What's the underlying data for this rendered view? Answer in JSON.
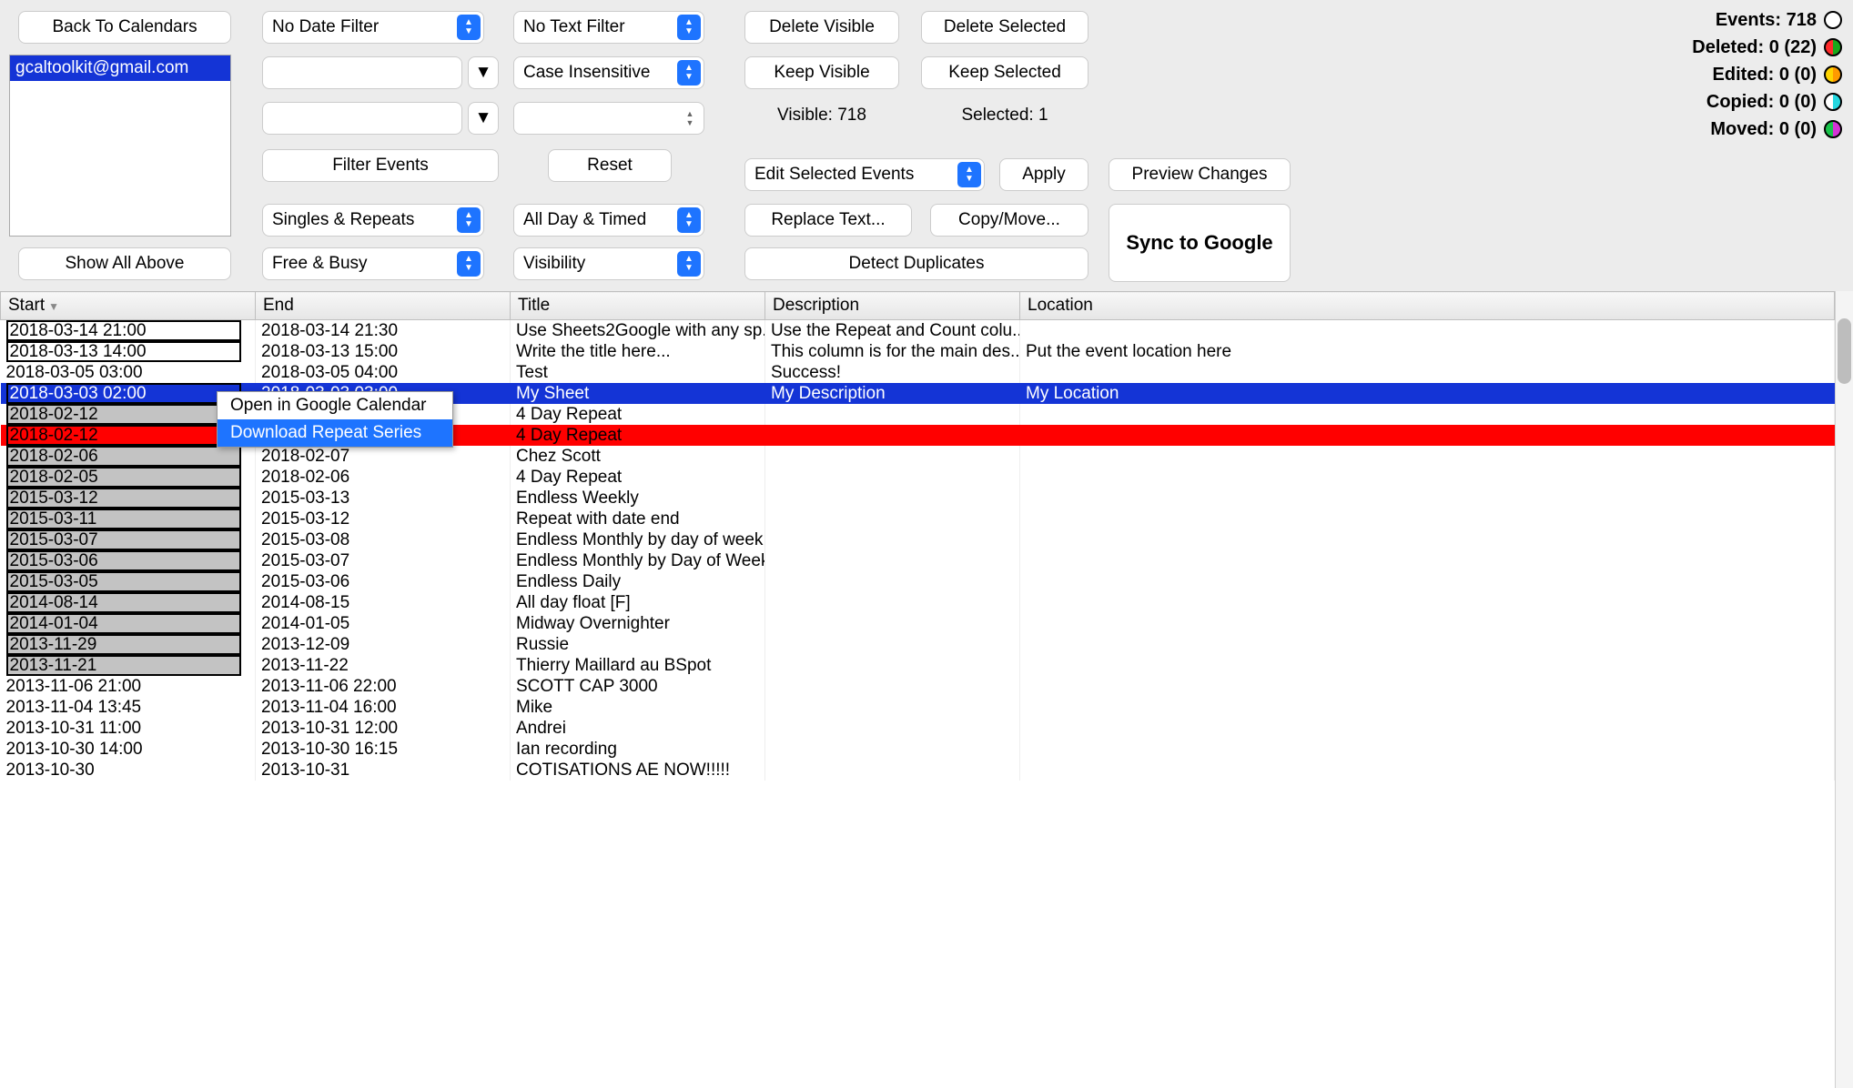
{
  "buttons": {
    "back": "Back To Calendars",
    "show_all": "Show All Above",
    "filter_events": "Filter Events",
    "reset": "Reset",
    "delete_visible": "Delete Visible",
    "delete_selected": "Delete Selected",
    "keep_visible": "Keep Visible",
    "keep_selected": "Keep Selected",
    "apply": "Apply",
    "replace_text": "Replace Text...",
    "copy_move": "Copy/Move...",
    "detect_dup": "Detect Duplicates",
    "preview": "Preview Changes",
    "sync": "Sync to Google"
  },
  "selects": {
    "date_filter": "No Date Filter",
    "text_filter": "No Text Filter",
    "case": "Case Insensitive",
    "singles": "Singles & Repeats",
    "allday": "All Day & Timed",
    "freebusy": "Free & Busy",
    "visibility": "Visibility",
    "edit_selected": "Edit Selected Events"
  },
  "calendars": [
    "gcaltoolkit@gmail.com"
  ],
  "status": {
    "visible": "Visible: 718",
    "selected": "Selected: 1"
  },
  "stats": {
    "events": "Events: 718",
    "deleted": "Deleted: 0 (22)",
    "edited": "Edited: 0 (0)",
    "copied": "Copied: 0 (0)",
    "moved": "Moved: 0 (0)"
  },
  "context_menu": {
    "open": "Open in Google Calendar",
    "download": "Download Repeat Series"
  },
  "columns": {
    "start": "Start",
    "end": "End",
    "title": "Title",
    "description": "Description",
    "location": "Location"
  },
  "rows": [
    {
      "start": "2018-03-14 21:00",
      "end": "2018-03-14 21:30",
      "title": "Use Sheets2Google with any sp...",
      "desc": "Use the Repeat and Count colu...",
      "loc": "",
      "box": true
    },
    {
      "start": "2018-03-13 14:00",
      "end": "2018-03-13 15:00",
      "title": "Write the title here...",
      "desc": "This column is for the main des...",
      "loc": "Put the event location here",
      "box": true
    },
    {
      "start": "2018-03-05 03:00",
      "end": "2018-03-05 04:00",
      "title": "Test",
      "desc": "Success!",
      "loc": ""
    },
    {
      "start": "2018-03-03 02:00",
      "end": "2018-03-03 03:00",
      "title": "My Sheet",
      "desc": "My Description",
      "loc": "My Location",
      "selected": true,
      "box": true
    },
    {
      "start": "2018-02-12",
      "end": "",
      "title": "4 Day Repeat",
      "desc": "",
      "loc": "",
      "gray": true,
      "box": true
    },
    {
      "start": "2018-02-12",
      "end": "",
      "title": "4 Day Repeat",
      "desc": "",
      "loc": "",
      "red": true,
      "box": true
    },
    {
      "start": "2018-02-06",
      "end": "2018-02-07",
      "title": "Chez Scott",
      "desc": "",
      "loc": "",
      "gray": true,
      "box": true
    },
    {
      "start": "2018-02-05",
      "end": "2018-02-06",
      "title": "4 Day Repeat",
      "desc": "",
      "loc": "",
      "gray": true,
      "box": true
    },
    {
      "start": "2015-03-12",
      "end": "2015-03-13",
      "title": "Endless Weekly",
      "desc": "",
      "loc": "",
      "gray": true,
      "box": true
    },
    {
      "start": "2015-03-11",
      "end": "2015-03-12",
      "title": "Repeat with date end",
      "desc": "",
      "loc": "",
      "gray": true,
      "box": true
    },
    {
      "start": "2015-03-07",
      "end": "2015-03-08",
      "title": "Endless Monthly by day of week",
      "desc": "",
      "loc": "",
      "gray": true,
      "box": true
    },
    {
      "start": "2015-03-06",
      "end": "2015-03-07",
      "title": "Endless Monthly by Day of Week",
      "desc": "",
      "loc": "",
      "gray": true,
      "box": true
    },
    {
      "start": "2015-03-05",
      "end": "2015-03-06",
      "title": "Endless Daily",
      "desc": "",
      "loc": "",
      "gray": true,
      "box": true
    },
    {
      "start": "2014-08-14",
      "end": "2014-08-15",
      "title": "All day float [F]",
      "desc": "",
      "loc": "",
      "gray": true,
      "box": true
    },
    {
      "start": "2014-01-04",
      "end": "2014-01-05",
      "title": "Midway Overnighter",
      "desc": "",
      "loc": "",
      "gray": true,
      "box": true
    },
    {
      "start": "2013-11-29",
      "end": "2013-12-09",
      "title": "Russie",
      "desc": "",
      "loc": "",
      "gray": true,
      "box": true
    },
    {
      "start": "2013-11-21",
      "end": "2013-11-22",
      "title": "Thierry Maillard au BSpot",
      "desc": "",
      "loc": "",
      "gray": true,
      "box": true
    },
    {
      "start": "2013-11-06 21:00",
      "end": "2013-11-06 22:00",
      "title": "SCOTT CAP 3000",
      "desc": "",
      "loc": ""
    },
    {
      "start": "2013-11-04 13:45",
      "end": "2013-11-04 16:00",
      "title": "Mike",
      "desc": "",
      "loc": ""
    },
    {
      "start": "2013-10-31 11:00",
      "end": "2013-10-31 12:00",
      "title": "Andrei",
      "desc": "",
      "loc": ""
    },
    {
      "start": "2013-10-30 14:00",
      "end": "2013-10-30 16:15",
      "title": "Ian recording",
      "desc": "",
      "loc": ""
    },
    {
      "start": "2013-10-30",
      "end": "2013-10-31",
      "title": "COTISATIONS AE NOW!!!!!",
      "desc": "",
      "loc": ""
    }
  ]
}
